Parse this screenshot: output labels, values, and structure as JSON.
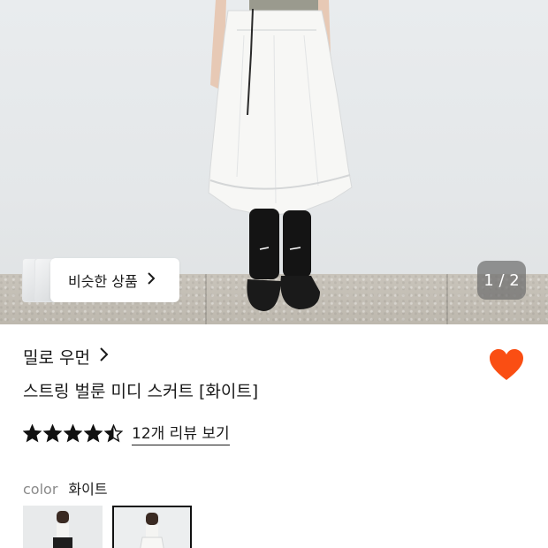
{
  "gallery": {
    "similar_button_label": "비슷한 상품",
    "image_counter": "1 / 2"
  },
  "product": {
    "brand": "밀로 우먼",
    "title": "스트링 벌룬 미디 스커트 [화이트]",
    "rating": 4.5,
    "review_link": "12개 리뷰 보기",
    "wishlist_active": true,
    "wishlist_color": "#fa4e13"
  },
  "options": {
    "color_label": "color",
    "color_value": "화이트",
    "selected_index": 1
  },
  "icons": {
    "chevron": "chevron-right-icon",
    "heart": "heart-filled-icon",
    "star": "star-icon"
  }
}
